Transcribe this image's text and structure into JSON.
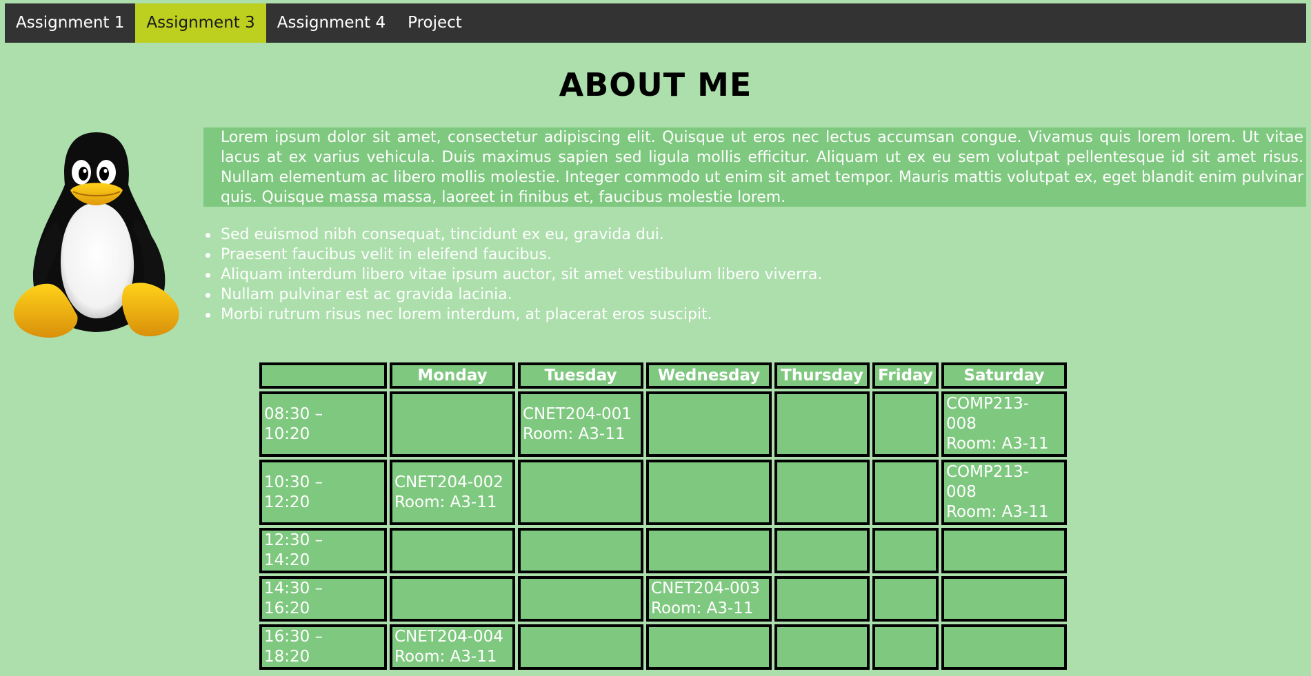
{
  "nav": {
    "items": [
      {
        "label": "Assignment 1"
      },
      {
        "label": "Assignment 3"
      },
      {
        "label": "Assignment 4"
      },
      {
        "label": "Project"
      }
    ],
    "active_index": 1
  },
  "page_title": "ABOUT ME",
  "intro": {
    "text": "Lorem ipsum dolor sit amet, consectetur adipiscing elit. Quisque ut eros nec lectus accumsan congue. Vivamus quis lorem lorem. Ut vitae lacus at ex varius vehicula. Duis maximus sapien sed ligula mollis efficitur. Aliquam ut ex eu sem volutpat pellentesque id sit amet risus. Nullam elementum ac libero mollis molestie. Integer commodo ut enim sit amet tempor. Mauris mattis volutpat ex, eget blandit enim pulvinar quis. Quisque massa massa, laoreet in finibus et, faucibus molestie lorem."
  },
  "bullets": [
    "Sed euismod nibh consequat, tincidunt ex eu, gravida dui.",
    "Praesent faucibus velit in eleifend faucibus.",
    "Aliquam interdum libero vitae ipsum auctor, sit amet vestibulum libero viverra.",
    "Nullam pulvinar est ac gravida lacinia.",
    "Morbi rutrum risus nec lorem interdum, at placerat eros suscipit."
  ],
  "schedule": {
    "days": [
      "Monday",
      "Tuesday",
      "Wednesday",
      "Thursday",
      "Friday",
      "Saturday"
    ],
    "rows": [
      {
        "time": [
          "08:30 –",
          "10:20"
        ],
        "cells": [
          [],
          [
            "CNET204-001",
            "Room: A3-11"
          ],
          [],
          [],
          [],
          [
            "COMP213-",
            "008",
            "Room: A3-11"
          ]
        ]
      },
      {
        "time": [
          "10:30 –",
          "12:20"
        ],
        "cells": [
          [
            "CNET204-002",
            "Room: A3-11"
          ],
          [],
          [],
          [],
          [],
          [
            "COMP213-",
            "008",
            "Room: A3-11"
          ]
        ]
      },
      {
        "time": [
          "12:30 –",
          "14:20"
        ],
        "cells": [
          [],
          [],
          [],
          [],
          [],
          []
        ]
      },
      {
        "time": [
          "14:30 –",
          "16:20"
        ],
        "cells": [
          [],
          [],
          [
            "CNET204-003",
            "Room: A3-11"
          ],
          [],
          [],
          []
        ]
      },
      {
        "time": [
          "16:30 –",
          "18:20"
        ],
        "cells": [
          [
            "CNET204-004",
            "Room: A3-11"
          ],
          [],
          [],
          [],
          [],
          []
        ]
      }
    ]
  },
  "colors": {
    "background": "#addfad",
    "nav_bg": "#333333",
    "nav_active": "#bdcf1f",
    "panel": "#7fc87f",
    "text": "#ffffff"
  },
  "icons": {
    "mascot": "tux-penguin-image"
  }
}
